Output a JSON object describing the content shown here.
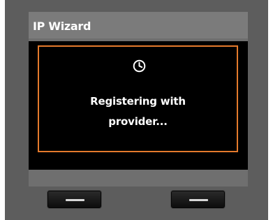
{
  "screen": {
    "title": "IP Wizard",
    "message_line1": "Registering with",
    "message_line2": "provider..."
  },
  "icons": {
    "status": "clock-icon"
  },
  "softkeys": {
    "left": "dash-icon",
    "right": "dash-icon"
  },
  "colors": {
    "accent": "#e47a2c",
    "display_bg": "#000000",
    "device_bg": "#5d5d5d"
  }
}
